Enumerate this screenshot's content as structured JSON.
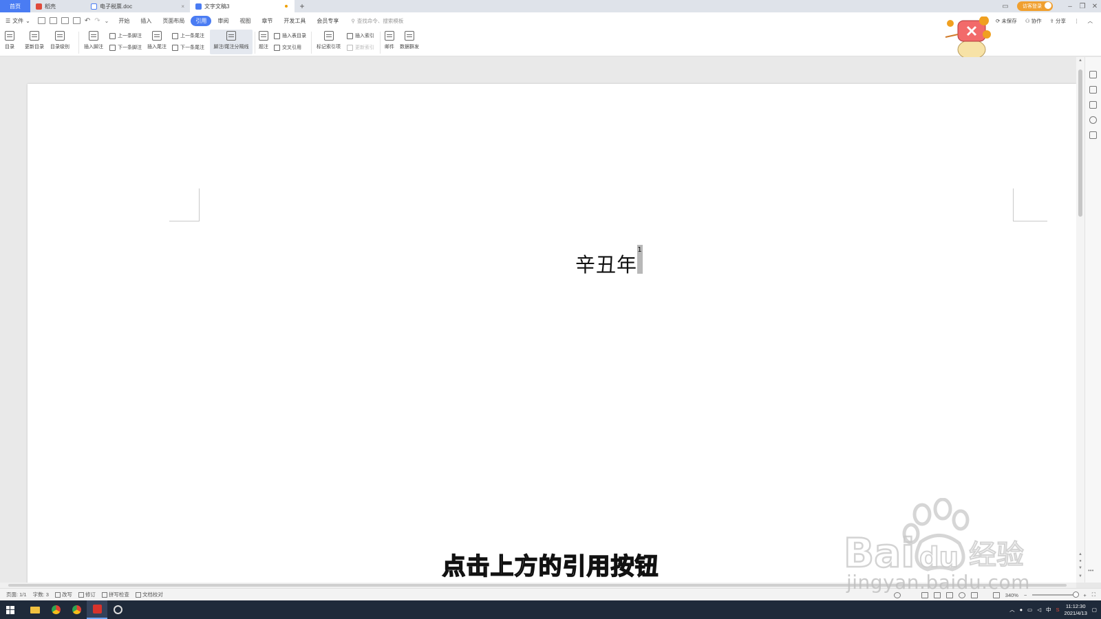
{
  "tabs": [
    {
      "label": "首页",
      "active": false,
      "color": "#4a7cf3"
    },
    {
      "label": "稻壳",
      "icon": "daoke-icon",
      "color": "#e04a3a"
    },
    {
      "label": "电子税票.doc",
      "icon": "doc-icon",
      "color": "#4a7cf3"
    },
    {
      "label": "文字文稿3",
      "icon": "doc-icon",
      "active": true,
      "color": "#4a7cf3",
      "unsaved": true
    }
  ],
  "window": {
    "login_label": "访客登录",
    "login_color": "#f0a030"
  },
  "menu": {
    "file_label": "文件",
    "tabs": [
      "开始",
      "插入",
      "页面布局",
      "引用",
      "审阅",
      "视图",
      "章节",
      "开发工具",
      "会员专享"
    ],
    "active_tab": "引用",
    "search_placeholder": "查找命令、搜索模板",
    "unsaved_label": "未保存",
    "collab_label": "协作",
    "share_label": "分享"
  },
  "ribbon": {
    "toc": "目录",
    "update_toc": "更新目录",
    "toc_level": "目录级别",
    "insert_footnote": "插入脚注",
    "prev_footnote": "上一条脚注",
    "next_footnote": "下一条脚注",
    "insert_endnote": "插入尾注",
    "prev_endnote": "上一条尾注",
    "next_endnote": "下一条尾注",
    "separator": "脚注/尾注分隔线",
    "caption": "题注",
    "insert_table_of_figures": "插入表目录",
    "cross_ref": "交叉引用",
    "mark_index": "标记索引项",
    "insert_index": "插入索引",
    "update_index": "更新索引",
    "mail": "邮件",
    "data_dist": "数据群发"
  },
  "document": {
    "text": "辛丑年",
    "footnote_mark": "1"
  },
  "status": {
    "page": "页面: 1/1",
    "words": "字数: 3",
    "rewrite": "改写",
    "revise": "修订",
    "spellcheck": "拼写检查",
    "proofread": "文档校对",
    "zoom": "340%"
  },
  "taskbar": {
    "time": "11:12:30",
    "date": "2021/4/13",
    "ime": "中",
    "bg": "#1f2a3a"
  },
  "overlay": {
    "subtitle": "点击上方的引用按钮",
    "watermark_url": "jingyan.baidu.com"
  }
}
